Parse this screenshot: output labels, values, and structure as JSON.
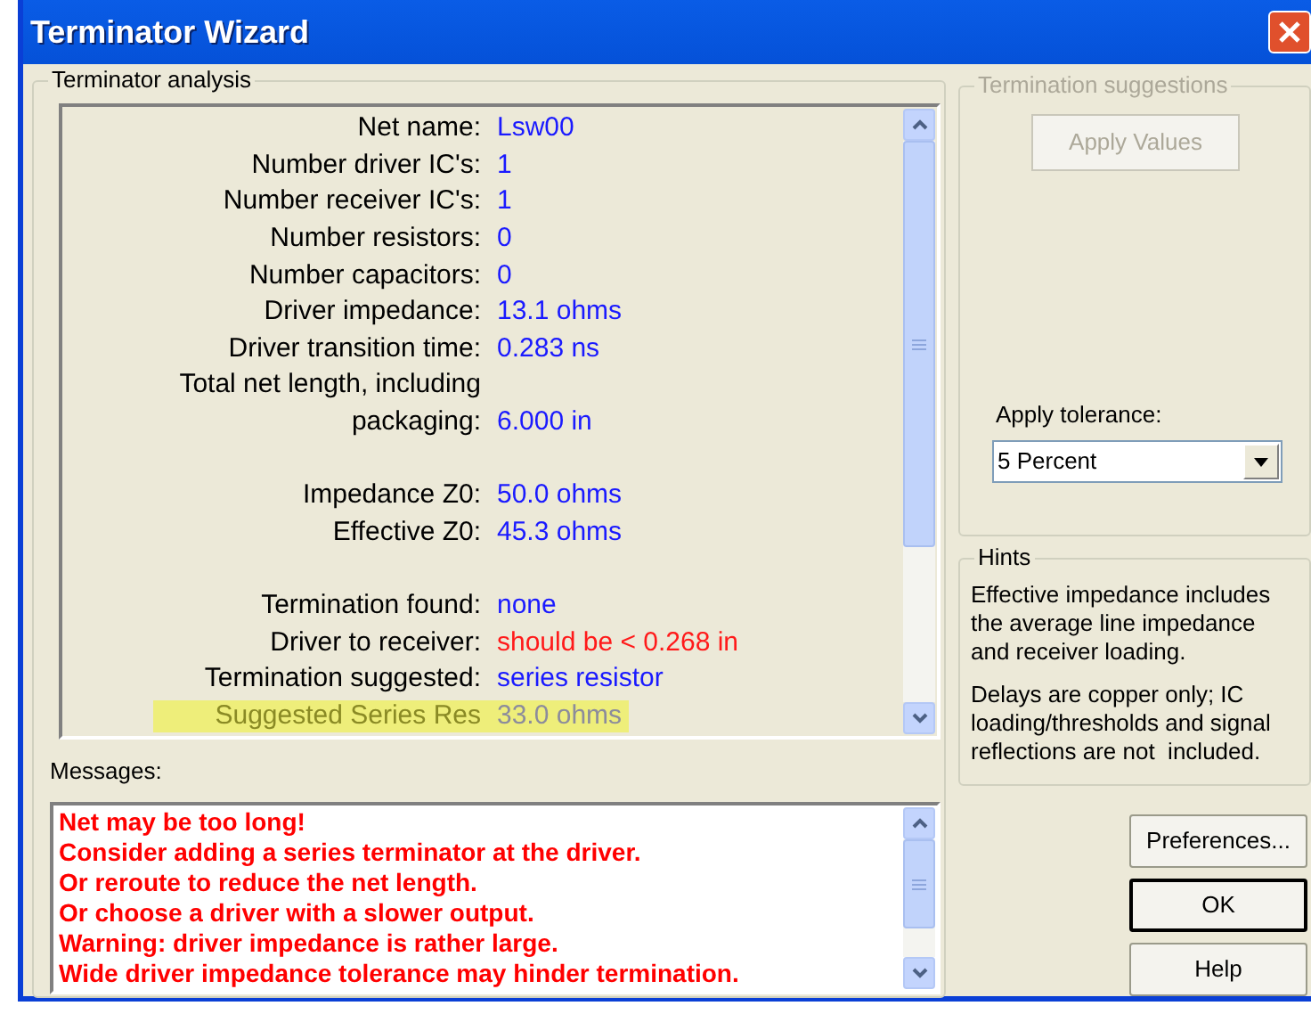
{
  "window": {
    "title": "Terminator Wizard"
  },
  "analysis": {
    "title": "Terminator analysis",
    "rows": [
      {
        "kind": "value",
        "label": "Net name:",
        "value": "Lsw00"
      },
      {
        "kind": "value",
        "label": "Number driver IC's:",
        "value": "1"
      },
      {
        "kind": "value",
        "label": "Number receiver IC's:",
        "value": "1"
      },
      {
        "kind": "value",
        "label": "Number resistors:",
        "value": "0"
      },
      {
        "kind": "value",
        "label": "Number capacitors:",
        "value": "0"
      },
      {
        "kind": "value",
        "label": "Driver impedance:",
        "value": "13.1 ohms"
      },
      {
        "kind": "value",
        "label": "Driver transition time:",
        "value": "0.283 ns"
      },
      {
        "kind": "label",
        "label": "Total net length, including"
      },
      {
        "kind": "value",
        "label": "packaging:",
        "value": "6.000 in"
      },
      {
        "kind": "spacer"
      },
      {
        "kind": "value",
        "label": "Impedance Z0:",
        "value": "50.0 ohms"
      },
      {
        "kind": "value",
        "label": "Effective Z0:",
        "value": "45.3 ohms"
      },
      {
        "kind": "spacer"
      },
      {
        "kind": "value",
        "label": "Termination found:",
        "value": "none"
      },
      {
        "kind": "warning",
        "label": "Driver to receiver:",
        "value": "should be < 0.268 in"
      },
      {
        "kind": "value",
        "label": "Termination suggested:",
        "value": "series resistor"
      },
      {
        "kind": "highlight",
        "label": "Suggested Series Res",
        "value": "33.0 ohms"
      }
    ]
  },
  "messages": {
    "label": "Messages:",
    "lines": [
      "Net may be too long!",
      "Consider adding a series terminator at the driver.",
      "Or reroute to reduce the net length.",
      "Or choose a driver with a slower output.",
      "Warning: driver impedance is rather large.",
      "Wide driver impedance tolerance may hinder termination."
    ]
  },
  "suggestions": {
    "title": "Termination suggestions",
    "disabled": true,
    "apply_button": "Apply Values",
    "tolerance_label": "Apply tolerance:",
    "tolerance_value": "5 Percent"
  },
  "hints": {
    "title": "Hints",
    "paragraphs": [
      "Effective impedance includes the average line impedance and receiver loading.",
      "Delays are copper only; IC loading/thresholds and signal reflections are not  included."
    ]
  },
  "buttons": [
    {
      "label": "Preferences...",
      "default": false
    },
    {
      "label": "OK",
      "default": true
    },
    {
      "label": "Help",
      "default": false
    }
  ]
}
